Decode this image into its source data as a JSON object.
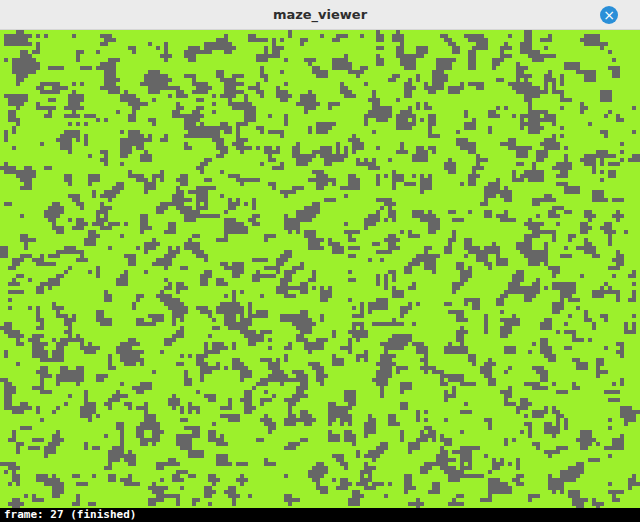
{
  "window": {
    "title": "maze_viewer",
    "close": "×"
  },
  "status_bar": {
    "text": "frame: 27 (finished)"
  }
}
